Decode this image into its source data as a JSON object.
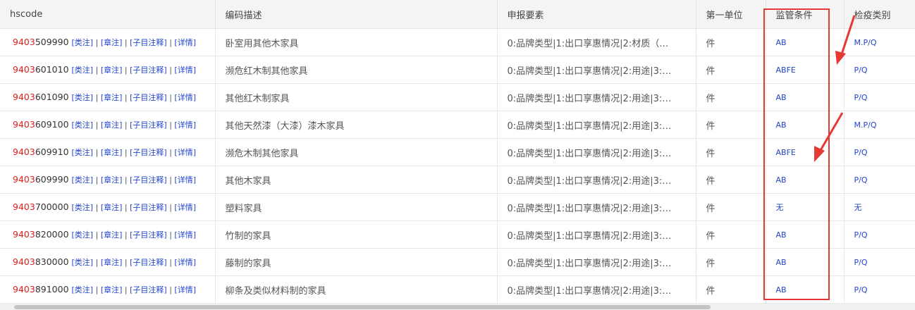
{
  "columns": [
    "hscode",
    "编码描述",
    "申报要素",
    "第一单位",
    "监管条件",
    "检疫类别"
  ],
  "links": [
    "[类注]",
    "[章注]",
    "[子目注释]",
    "[详情]"
  ],
  "rows": [
    {
      "prefix": "9403",
      "rest": "509990",
      "desc": "卧室用其他木家具",
      "elements": "0:品牌类型|1:出口享惠情况|2:材质（…",
      "unit": "件",
      "supervision": "AB",
      "quarantine": "M.P/Q"
    },
    {
      "prefix": "9403",
      "rest": "601010",
      "desc": "濒危红木制其他家具",
      "elements": "0:品牌类型|1:出口享惠情况|2:用途|3:…",
      "unit": "件",
      "supervision": "ABFE",
      "quarantine": "P/Q"
    },
    {
      "prefix": "9403",
      "rest": "601090",
      "desc": "其他红木制家具",
      "elements": "0:品牌类型|1:出口享惠情况|2:用途|3:…",
      "unit": "件",
      "supervision": "AB",
      "quarantine": "P/Q"
    },
    {
      "prefix": "9403",
      "rest": "609100",
      "desc": "其他天然漆（大漆）漆木家具",
      "elements": "0:品牌类型|1:出口享惠情况|2:用途|3:…",
      "unit": "件",
      "supervision": "AB",
      "quarantine": "M.P/Q"
    },
    {
      "prefix": "9403",
      "rest": "609910",
      "desc": "濒危木制其他家具",
      "elements": "0:品牌类型|1:出口享惠情况|2:用途|3:…",
      "unit": "件",
      "supervision": "ABFE",
      "quarantine": "P/Q"
    },
    {
      "prefix": "9403",
      "rest": "609990",
      "desc": "其他木家具",
      "elements": "0:品牌类型|1:出口享惠情况|2:用途|3:…",
      "unit": "件",
      "supervision": "AB",
      "quarantine": "P/Q"
    },
    {
      "prefix": "9403",
      "rest": "700000",
      "desc": "塑料家具",
      "elements": "0:品牌类型|1:出口享惠情况|2:用途|3:…",
      "unit": "件",
      "supervision": "无",
      "quarantine": "无"
    },
    {
      "prefix": "9403",
      "rest": "820000",
      "desc": "竹制的家具",
      "elements": "0:品牌类型|1:出口享惠情况|2:用途|3:…",
      "unit": "件",
      "supervision": "AB",
      "quarantine": "P/Q"
    },
    {
      "prefix": "9403",
      "rest": "830000",
      "desc": "藤制的家具",
      "elements": "0:品牌类型|1:出口享惠情况|2:用途|3:…",
      "unit": "件",
      "supervision": "AB",
      "quarantine": "P/Q"
    },
    {
      "prefix": "9403",
      "rest": "891000",
      "desc": "柳条及类似材料制的家具",
      "elements": "0:品牌类型|1:出口享惠情况|2:用途|3:…",
      "unit": "件",
      "supervision": "AB",
      "quarantine": "P/Q"
    }
  ],
  "colors": {
    "hs_prefix": "#e02020",
    "link": "#2244cc",
    "highlight": "#e53935"
  }
}
